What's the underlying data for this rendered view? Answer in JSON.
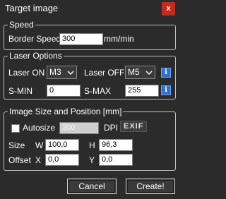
{
  "window": {
    "title": "Target image",
    "close_label": "x"
  },
  "speed": {
    "legend": "Speed",
    "border_speed_label": "Border Speed",
    "border_speed_value": "300",
    "unit": "mm/min"
  },
  "laser": {
    "legend": "Laser Options",
    "laser_on_label": "Laser ON",
    "laser_on_value": "M3",
    "laser_off_label": "Laser OFF",
    "laser_off_value": "M5",
    "smin_label": "S-MIN",
    "smin_value": "0",
    "smax_label": "S-MAX",
    "smax_value": "255",
    "info_icon_glyph": "i"
  },
  "image": {
    "legend": "Image Size and Position [mm]",
    "autosize_label": "Autosize",
    "autosize_checked": false,
    "dpi_value": "300",
    "dpi_label": "DPI",
    "exif_label": "EXIF",
    "size_label": "Size",
    "w_label": "W",
    "w_value": "100,0",
    "h_label": "H",
    "h_value": "96,3",
    "offset_label": "Offset",
    "x_label": "X",
    "x_value": "0,0",
    "y_label": "Y",
    "y_value": "0,0"
  },
  "buttons": {
    "cancel_label": "Cancel",
    "create_label": "Create!"
  },
  "colors": {
    "background": "#2b2b2b",
    "close": "#c42b1c",
    "info": "#2f6fd0"
  }
}
